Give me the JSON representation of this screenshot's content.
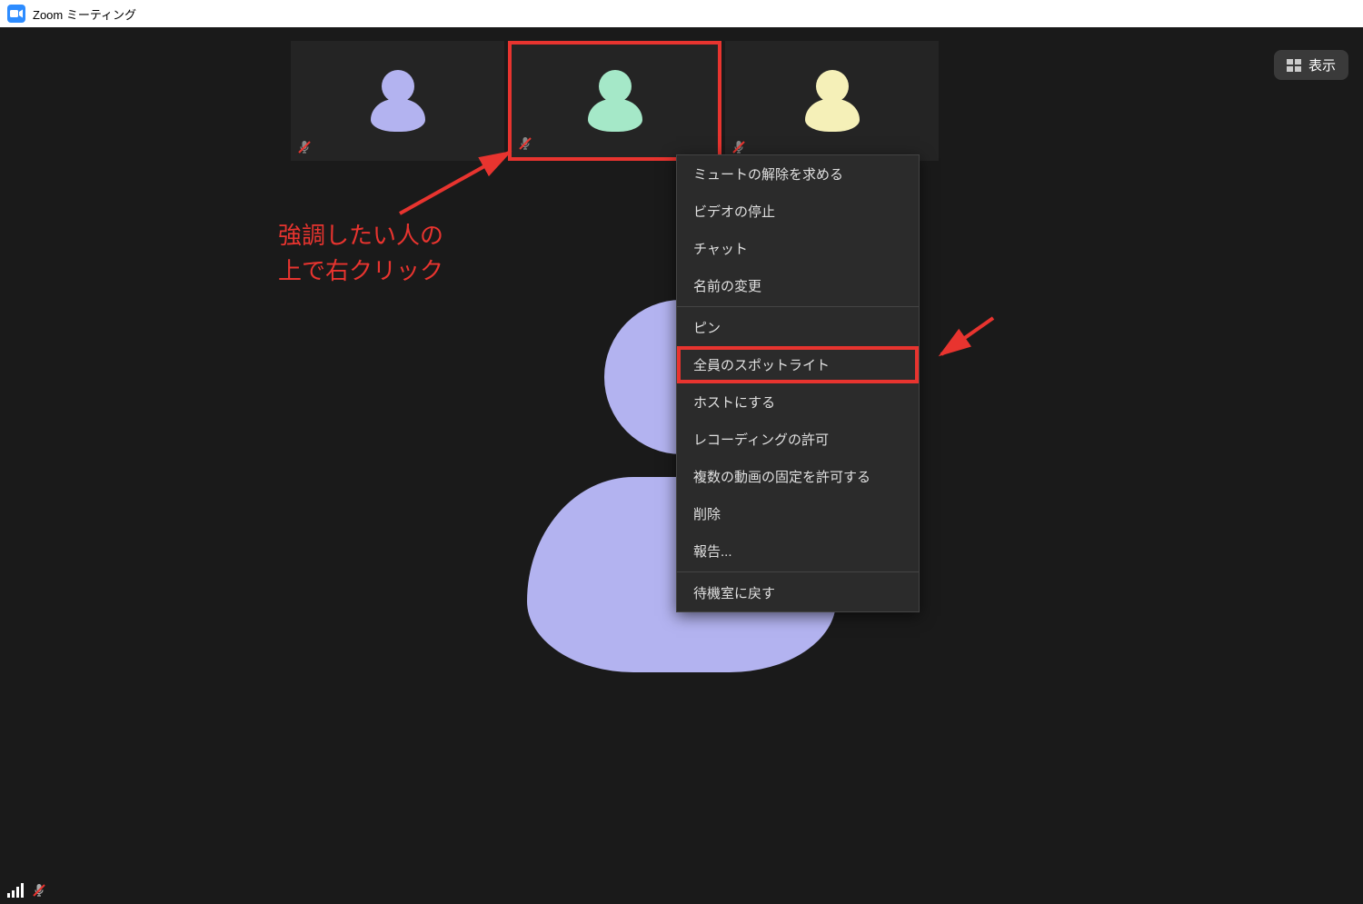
{
  "titlebar": {
    "app_title": "Zoom ミーティング"
  },
  "view_button": {
    "label": "表示"
  },
  "participants": [
    {
      "color": "lavender",
      "muted": true,
      "highlighted": false
    },
    {
      "color": "mint",
      "muted": true,
      "highlighted": true
    },
    {
      "color": "cream",
      "muted": true,
      "highlighted": false
    }
  ],
  "context_menu": {
    "groups": [
      {
        "items": [
          "ミュートの解除を求める",
          "ビデオの停止",
          "チャット",
          "名前の変更"
        ]
      },
      {
        "items": [
          "ピン",
          "全員のスポットライト",
          "ホストにする",
          "レコーディングの許可",
          "複数の動画の固定を許可する",
          "削除",
          "報告..."
        ],
        "highlighted_index": 1
      },
      {
        "items": [
          "待機室に戻す"
        ]
      }
    ]
  },
  "annotation": {
    "line1": "強調したい人の",
    "line2": "上で右クリック"
  },
  "colors": {
    "highlight_red": "#e8342f",
    "lavender": "#b3b3f0",
    "mint": "#a5e8c8",
    "cream": "#f5f0b8"
  }
}
